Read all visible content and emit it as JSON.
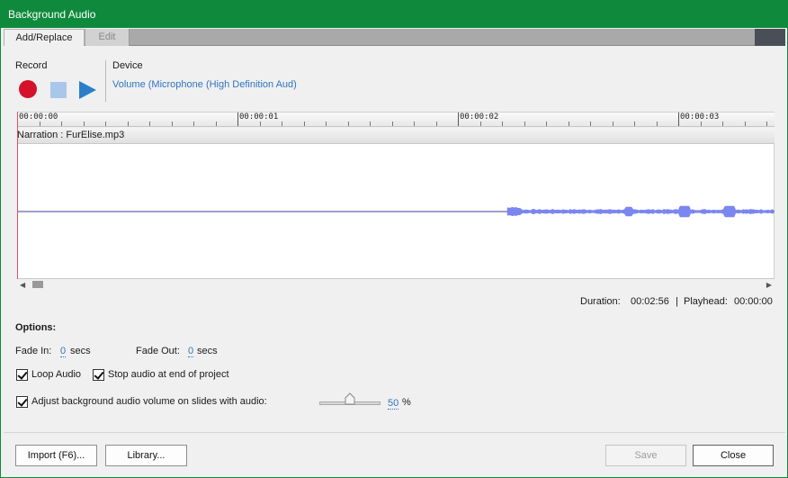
{
  "window": {
    "title": "Background Audio"
  },
  "tabs": [
    {
      "label": "Add/Replace",
      "active": true
    },
    {
      "label": "Edit",
      "active": false
    }
  ],
  "record": {
    "label": "Record",
    "buttons": [
      "record-icon",
      "stop-icon",
      "play-icon"
    ]
  },
  "device": {
    "label": "Device",
    "value": "Volume (Microphone (High Definition Aud)"
  },
  "timeline": {
    "ticks": [
      "00:00:00",
      "00:00:01",
      "00:00:02",
      "00:00:03"
    ],
    "track_label": "Narration : FurElise.mp3"
  },
  "status": {
    "duration_label": "Duration:",
    "duration_value": "00:02:56",
    "separator": "|",
    "playhead_label": "Playhead:",
    "playhead_value": "00:00:00"
  },
  "options": {
    "heading": "Options:",
    "fade_in_label": "Fade In:",
    "fade_in_value": "0",
    "fade_out_label": "Fade Out:",
    "fade_out_value": "0",
    "secs": "secs",
    "loop_audio": {
      "label": "Loop Audio",
      "checked": true
    },
    "stop_audio": {
      "label": "Stop audio at end of project",
      "checked": true
    },
    "adjust_volume": {
      "label": "Adjust background audio volume on slides with audio:",
      "checked": true
    },
    "volume_value": "50",
    "volume_unit": "%"
  },
  "buttons": {
    "import": "Import (F6)...",
    "library": "Library...",
    "save": "Save",
    "close": "Close"
  },
  "colors": {
    "title_bar": "#0f8a3c",
    "record": "#d4122a",
    "play": "#2a7fc8",
    "link": "#2e75c0",
    "waveform": "#7b86f0"
  }
}
